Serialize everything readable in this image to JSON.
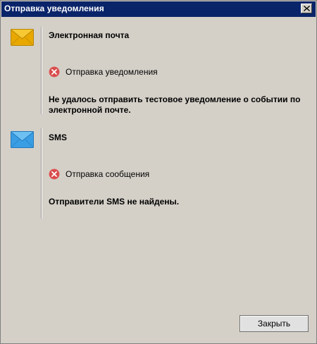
{
  "window": {
    "title": "Отправка уведомления"
  },
  "sections": [
    {
      "icon": "envelope-yellow-icon",
      "icon_color": "#f0b400",
      "heading": "Электронная почта",
      "status_icon": "error-icon",
      "status": "Отправка уведомления",
      "message": "Не удалось отправить тестовое уведомление о событии по электронной почте."
    },
    {
      "icon": "envelope-blue-icon",
      "icon_color": "#3aa0e6",
      "heading": "SMS",
      "status_icon": "error-icon",
      "status": "Отправка сообщения",
      "message": "Отправители SMS не найдены."
    }
  ],
  "footer": {
    "close_label": "Закрыть"
  },
  "colors": {
    "titlebar": "#0a246a",
    "error": "#e05a5a",
    "background": "#d4d0c8"
  }
}
